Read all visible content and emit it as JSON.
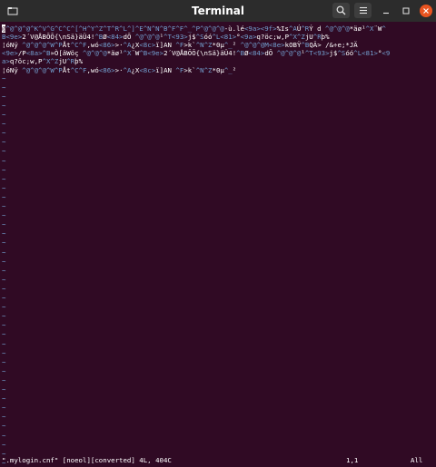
{
  "window": {
    "title": "Terminal",
    "icons": {
      "new_tab": "tab-icon",
      "search": "search-icon",
      "menu": "hamburger-menu-icon",
      "minimize": "minimize-icon",
      "maximize": "maximize-icon",
      "close": "close-icon"
    },
    "accent_close": "#e95420",
    "background": "#300a24",
    "escape_color": "#729fcf"
  },
  "editor": {
    "lines": [
      [
        {
          "t": "c",
          "v": "@"
        },
        {
          "t": "e",
          "v": "^@^@^@^K^V^G^C^C^[^H^Y^Z^T^R^L^]^E^N^N^B^F^F^_^P^@^@^@"
        },
        {
          "t": "n",
          "v": "-ù.lé"
        },
        {
          "t": "e",
          "v": "<9a><9f>"
        },
        {
          "t": "n",
          "v": "%Is"
        },
        {
          "t": "e",
          "v": "^A"
        },
        {
          "t": "n",
          "v": "Ú"
        },
        {
          "t": "e",
          "v": "^R"
        },
        {
          "t": "n",
          "v": "Ý d "
        },
        {
          "t": "e",
          "v": "^@^@^@"
        },
        {
          "t": "n",
          "v": "*äø¹"
        },
        {
          "t": "e",
          "v": "^X"
        },
        {
          "t": "n",
          "v": "¨W"
        },
        {
          "t": "e",
          "v": "^"
        }
      ],
      [
        {
          "t": "e",
          "v": "B<9e>"
        },
        {
          "t": "n",
          "v": "2´V@ÅBÕÕ{\\nSä}äÜ4!"
        },
        {
          "t": "e",
          "v": "^B"
        },
        {
          "t": "n",
          "v": "Ø"
        },
        {
          "t": "e",
          "v": "<84>"
        },
        {
          "t": "n",
          "v": "dÕ "
        },
        {
          "t": "e",
          "v": "^@^@^@"
        },
        {
          "t": "n",
          "v": "¹"
        },
        {
          "t": "e",
          "v": "^T<93>"
        },
        {
          "t": "n",
          "v": "j$"
        },
        {
          "t": "e",
          "v": "^S"
        },
        {
          "t": "n",
          "v": "óó"
        },
        {
          "t": "e",
          "v": "^L<81>"
        },
        {
          "t": "n",
          "v": "°"
        },
        {
          "t": "e",
          "v": "<9a>"
        },
        {
          "t": "n",
          "v": "q?öc;w,P"
        },
        {
          "t": "e",
          "v": "^X^Z"
        },
        {
          "t": "n",
          "v": "jU"
        },
        {
          "t": "e",
          "v": "^R"
        },
        {
          "t": "n",
          "v": "þ%"
        }
      ],
      [
        {
          "t": "n",
          "v": "¦óNÿ "
        },
        {
          "t": "e",
          "v": "^@^@^@^W^P"
        },
        {
          "t": "n",
          "v": "Åt"
        },
        {
          "t": "e",
          "v": "^C^F"
        },
        {
          "t": "n",
          "v": ",wó"
        },
        {
          "t": "e",
          "v": "<86>"
        },
        {
          "t": "n",
          "v": ">·"
        },
        {
          "t": "e",
          "v": "^A"
        },
        {
          "t": "n",
          "v": "¿X"
        },
        {
          "t": "e",
          "v": "<8c>"
        },
        {
          "t": "n",
          "v": "ï]AN "
        },
        {
          "t": "e",
          "v": "^F"
        },
        {
          "t": "n",
          "v": ">k`"
        },
        {
          "t": "e",
          "v": "^N^Z"
        },
        {
          "t": "n",
          "v": "*0µ"
        },
        {
          "t": "e",
          "v": "^_"
        },
        {
          "t": "n",
          "v": "² "
        },
        {
          "t": "e",
          "v": "^@^@^@M<8e>"
        },
        {
          "t": "n",
          "v": "kOBŸ"
        },
        {
          "t": "e",
          "v": "^B"
        },
        {
          "t": "n",
          "v": "QÄ> /&÷e;*JÄ"
        }
      ],
      [
        {
          "t": "e",
          "v": "<9e>"
        },
        {
          "t": "n",
          "v": "/P"
        },
        {
          "t": "e",
          "v": "<8a>^B"
        },
        {
          "t": "n",
          "v": "»Ò[äWöç "
        },
        {
          "t": "e",
          "v": "^@^@^@"
        },
        {
          "t": "n",
          "v": "*äø¹"
        },
        {
          "t": "e",
          "v": "^X"
        },
        {
          "t": "n",
          "v": "¨W"
        },
        {
          "t": "e",
          "v": "^B<9e>"
        },
        {
          "t": "n",
          "v": "2´V@ÅBÕÕ{\\nSä}äÜ4!"
        },
        {
          "t": "e",
          "v": "^B"
        },
        {
          "t": "n",
          "v": "Ø"
        },
        {
          "t": "e",
          "v": "<84>"
        },
        {
          "t": "n",
          "v": "dÕ "
        },
        {
          "t": "e",
          "v": "^@^@^@"
        },
        {
          "t": "n",
          "v": "¹"
        },
        {
          "t": "e",
          "v": "^T<93>"
        },
        {
          "t": "n",
          "v": "j$"
        },
        {
          "t": "e",
          "v": "^S"
        },
        {
          "t": "n",
          "v": "óó"
        },
        {
          "t": "e",
          "v": "^L<81>"
        },
        {
          "t": "n",
          "v": "°"
        },
        {
          "t": "e",
          "v": "<9"
        }
      ],
      [
        {
          "t": "e",
          "v": "a>"
        },
        {
          "t": "n",
          "v": "q?öc;w,P"
        },
        {
          "t": "e",
          "v": "^X^Z"
        },
        {
          "t": "n",
          "v": "jU"
        },
        {
          "t": "e",
          "v": "^R"
        },
        {
          "t": "n",
          "v": "þ%"
        }
      ],
      [
        {
          "t": "n",
          "v": "¦óNÿ "
        },
        {
          "t": "e",
          "v": "^@^@^@^W^P"
        },
        {
          "t": "n",
          "v": "Åt"
        },
        {
          "t": "e",
          "v": "^C^F"
        },
        {
          "t": "n",
          "v": ",wó"
        },
        {
          "t": "e",
          "v": "<86>"
        },
        {
          "t": "n",
          "v": ">·"
        },
        {
          "t": "e",
          "v": "^A"
        },
        {
          "t": "n",
          "v": "¿X"
        },
        {
          "t": "e",
          "v": "<8c>"
        },
        {
          "t": "n",
          "v": "ï]AN "
        },
        {
          "t": "e",
          "v": "^F"
        },
        {
          "t": "n",
          "v": ">k`"
        },
        {
          "t": "e",
          "v": "^N^Z"
        },
        {
          "t": "n",
          "v": "*0µ"
        },
        {
          "t": "e",
          "v": "^_"
        },
        {
          "t": "n",
          "v": "²"
        }
      ]
    ],
    "tilde_char": "~",
    "tilde_rows": 43
  },
  "statusline": {
    "file_info": "\".mylogin.cnf\" [noeol][converted] 4L, 404C",
    "cursor_position": "1,1",
    "scroll_position": "All"
  }
}
